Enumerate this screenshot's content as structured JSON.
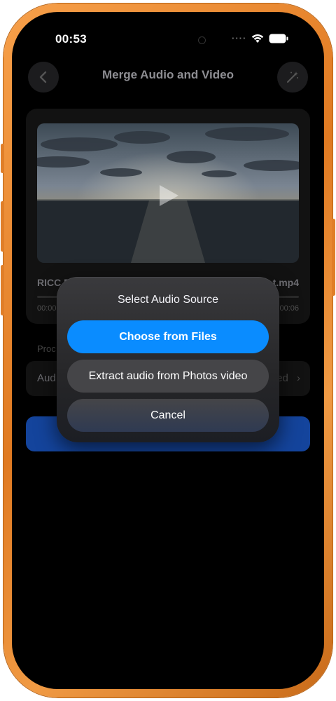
{
  "status_bar": {
    "time": "00:53"
  },
  "nav": {
    "title": "Merge Audio and Video",
    "back_icon": "chevron-left-icon",
    "magic_icon": "magic-wand-icon"
  },
  "video_card": {
    "file_name_left": "RICC P",
    "file_name_right": "t.mp4",
    "time_start": "00:00",
    "time_end": "00:06"
  },
  "audio_section": {
    "label": "Proc",
    "row_label": "Aud",
    "row_value": "ed"
  },
  "popup": {
    "title": "Select Audio Source",
    "choose_files": "Choose from Files",
    "extract_photos": "Extract audio from Photos video",
    "cancel": "Cancel"
  },
  "colors": {
    "frame": "#e8872e",
    "primary": "#0a8cff",
    "merge_button": "#14449c"
  }
}
